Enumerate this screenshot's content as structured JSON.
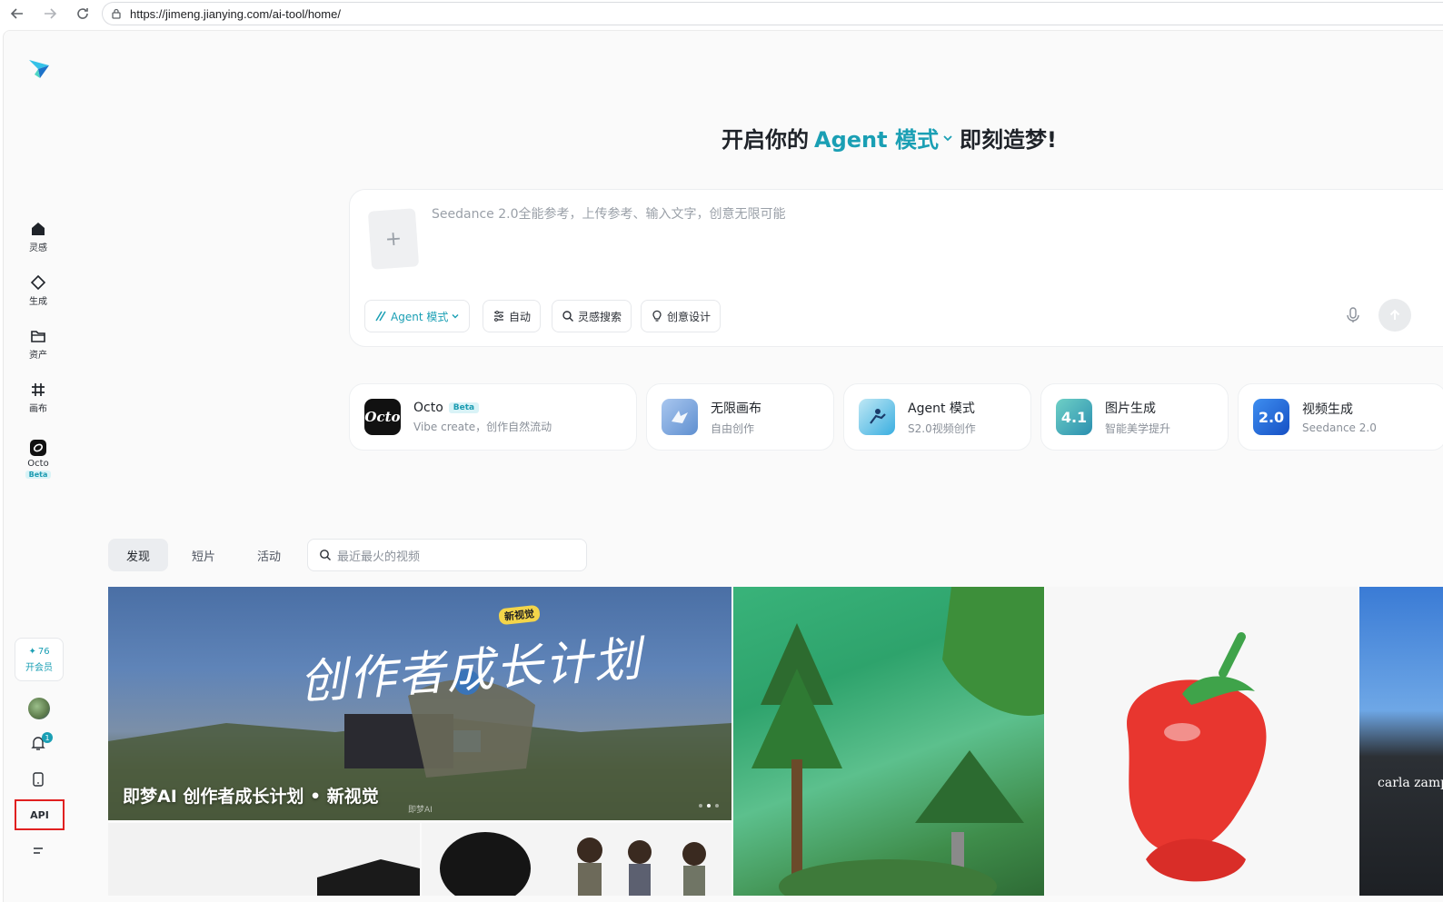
{
  "browser": {
    "url": "https://jimeng.jianying.com/ai-tool/home/"
  },
  "sidebar": {
    "items": [
      {
        "label": "灵感",
        "icon": "home-icon"
      },
      {
        "label": "生成",
        "icon": "diamond-icon"
      },
      {
        "label": "资产",
        "icon": "folder-icon"
      },
      {
        "label": "画布",
        "icon": "canvas-grid-icon"
      },
      {
        "label": "Octo",
        "icon": "octo-icon",
        "badge": "Beta"
      }
    ],
    "vip": {
      "points": "76",
      "label": "开会员"
    },
    "notification_count": "1",
    "api_label": "API"
  },
  "hero": {
    "prefix": "开启你的",
    "mode": "Agent 模式",
    "suffix": "即刻造梦!"
  },
  "prompt": {
    "placeholder": "Seedance 2.0全能参考，上传参考、输入文字，创意无限可能",
    "upload_symbol": "+",
    "chips": [
      "Agent 模式",
      "自动",
      "灵感搜索",
      "创意设计"
    ]
  },
  "tools": [
    {
      "title": "Octo",
      "badge": "Beta",
      "subtitle": "Vibe create，创作自然流动",
      "icon_text": "Octo",
      "color": "#111111"
    },
    {
      "title": "无限画布",
      "subtitle": "自由创作",
      "color": "#7fa7d8"
    },
    {
      "title": "Agent 模式",
      "subtitle": "S2.0视频创作",
      "color": "#44b6dc"
    },
    {
      "title": "图片生成",
      "subtitle": "智能美学提升",
      "icon_text": "4.1",
      "color": "#2ba0a8"
    },
    {
      "title": "视频生成",
      "subtitle": "Seedance 2.0",
      "icon_text": "2.0",
      "color": "#1f6fd6"
    }
  ],
  "feed": {
    "tabs": [
      "发现",
      "短片",
      "活动"
    ],
    "active_tab": "发现",
    "search_placeholder": "最近最火的视频",
    "banner_title": "即梦AI 创作者成长计划 • 新视觉",
    "banner_art_text": "创作者成长计划",
    "banner_tag": "新视觉",
    "banner_watermark": "即梦AI",
    "store_sign": "carla zamp"
  },
  "colors": {
    "accent": "#1a9fb4",
    "highlight": "#e02020"
  }
}
